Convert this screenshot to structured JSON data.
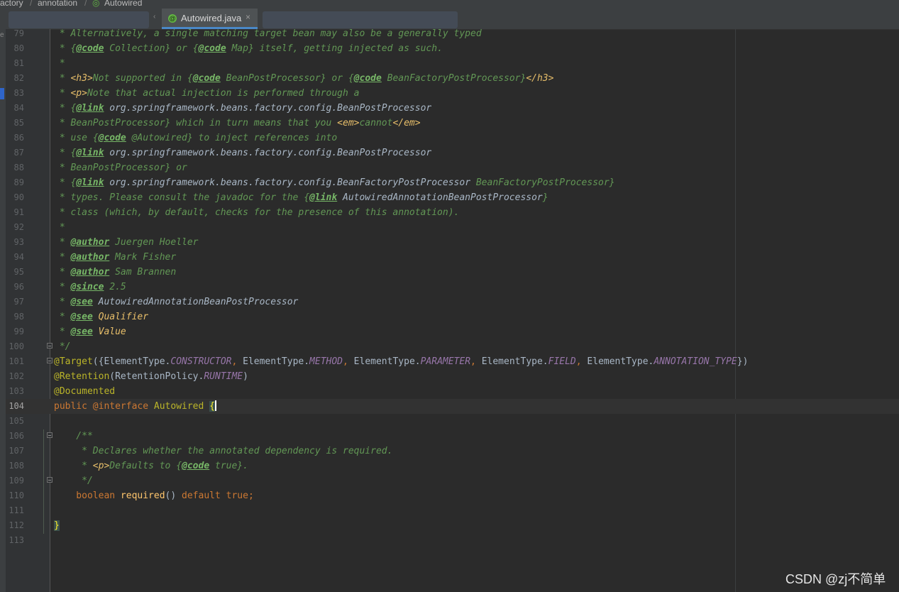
{
  "breadcrumbs": [
    "actory",
    "annotation",
    "Autowired"
  ],
  "tab": {
    "label": "Autowired.java",
    "close": "×",
    "icon": "annotation-file-icon"
  },
  "gutter": {
    "lines": [
      "79",
      "80",
      "81",
      "82",
      "83",
      "84",
      "85",
      "86",
      "87",
      "88",
      "89",
      "90",
      "91",
      "92",
      "93",
      "94",
      "95",
      "96",
      "97",
      "98",
      "99",
      "100",
      "101",
      "102",
      "103",
      "104",
      "105",
      "106",
      "107",
      "108",
      "109",
      "110",
      "111",
      "112",
      "113"
    ]
  },
  "code": {
    "l79": {
      "t1": " * Alternatively, a single matching target bean may also be a generally typed"
    },
    "l80": {
      "t1": " * {",
      "t2": "@code",
      "t3": " Collection} or {",
      "t4": "@code",
      "t5": " Map} itself, getting injected as such."
    },
    "l81": {
      "t1": " *"
    },
    "l82": {
      "t1": " * ",
      "t2": "<h3>",
      "t3": "Not supported in {",
      "t4": "@code",
      "t5": " BeanPostProcessor} or {",
      "t6": "@code",
      "t7": " BeanFactoryPostProcessor}",
      "t8": "</h3>"
    },
    "l83": {
      "t1": " * ",
      "t2": "<p>",
      "t3": "Note that actual injection is performed through a"
    },
    "l84": {
      "t1": " * {",
      "t2": "@link",
      "t3": " ",
      "t4": "org.springframework.beans.factory.config.BeanPostProcessor"
    },
    "l85": {
      "t1": " * BeanPostProcessor} which in turn means that you ",
      "t2": "<em>",
      "t3": "cannot",
      "t4": "</em>"
    },
    "l86": {
      "t1": " * use {",
      "t2": "@code",
      "t3": " @Autowired} to inject references into"
    },
    "l87": {
      "t1": " * {",
      "t2": "@link",
      "t3": " ",
      "t4": "org.springframework.beans.factory.config.BeanPostProcessor"
    },
    "l88": {
      "t1": " * BeanPostProcessor} or"
    },
    "l89": {
      "t1": " * {",
      "t2": "@link",
      "t3": " ",
      "t4": "org.springframework.beans.factory.config.BeanFactoryPostProcessor",
      "t5": " BeanFactoryPostProcessor}"
    },
    "l90": {
      "t1": " * types. Please consult the javadoc for the {",
      "t2": "@link",
      "t3": " ",
      "t4": "AutowiredAnnotationBeanPostProcessor",
      "t5": "}"
    },
    "l91": {
      "t1": " * class (which, by default, checks for the presence of this annotation)."
    },
    "l92": {
      "t1": " *"
    },
    "l93": {
      "t1": " * ",
      "t2": "@author",
      "t3": " Juergen Hoeller"
    },
    "l94": {
      "t1": " * ",
      "t2": "@author",
      "t3": " Mark Fisher"
    },
    "l95": {
      "t1": " * ",
      "t2": "@author",
      "t3": " Sam Brannen"
    },
    "l96": {
      "t1": " * ",
      "t2": "@since",
      "t3": " 2.5"
    },
    "l97": {
      "t1": " * ",
      "t2": "@see",
      "t3": " ",
      "t4": "AutowiredAnnotationBeanPostProcessor"
    },
    "l98": {
      "t1": " * ",
      "t2": "@see",
      "t3": " ",
      "t4": "Qualifier"
    },
    "l99": {
      "t1": " * ",
      "t2": "@see",
      "t3": " ",
      "t4": "Value"
    },
    "l100": {
      "t1": " */"
    },
    "l101": {
      "t1": "@Target",
      "t2": "({ElementType.",
      "t3": "CONSTRUCTOR",
      "t4": ", ",
      "t5": "ElementType.",
      "t6": "METHOD",
      "t7": ", ",
      "t8": "ElementType.",
      "t9": "PARAMETER",
      "t10": ", ",
      "t11": "ElementType.",
      "t12": "FIELD",
      "t13": ", ",
      "t14": "ElementType.",
      "t15": "ANNOTATION_TYPE",
      "t16": "})"
    },
    "l102": {
      "t1": "@Retention",
      "t2": "(RetentionPolicy.",
      "t3": "RUNTIME",
      "t4": ")"
    },
    "l103": {
      "t1": "@Documented"
    },
    "l104": {
      "t1": "public ",
      "t2": "@interface ",
      "t3": "Autowired ",
      "t4": "{"
    },
    "l106": {
      "t1": "    /**"
    },
    "l107": {
      "t1": "     * Declares whether the annotated dependency is required."
    },
    "l108": {
      "t1": "     * ",
      "t2": "<p>",
      "t3": "Defaults to {",
      "t4": "@code",
      "t5": " true}."
    },
    "l109": {
      "t1": "     */"
    },
    "l110": {
      "t1": "    boolean ",
      "t2": "required",
      "t3": "() ",
      "t4": "default ",
      "t5": "true",
      "t6": ";"
    },
    "l112": {
      "t1": "}"
    }
  },
  "watermark": "CSDN @zj不简单",
  "colors": {
    "background": "#2b2b2b",
    "comment": "#629755",
    "keyword": "#cc7832",
    "annotation": "#bbb529",
    "tab_accent": "#4a88c7"
  }
}
